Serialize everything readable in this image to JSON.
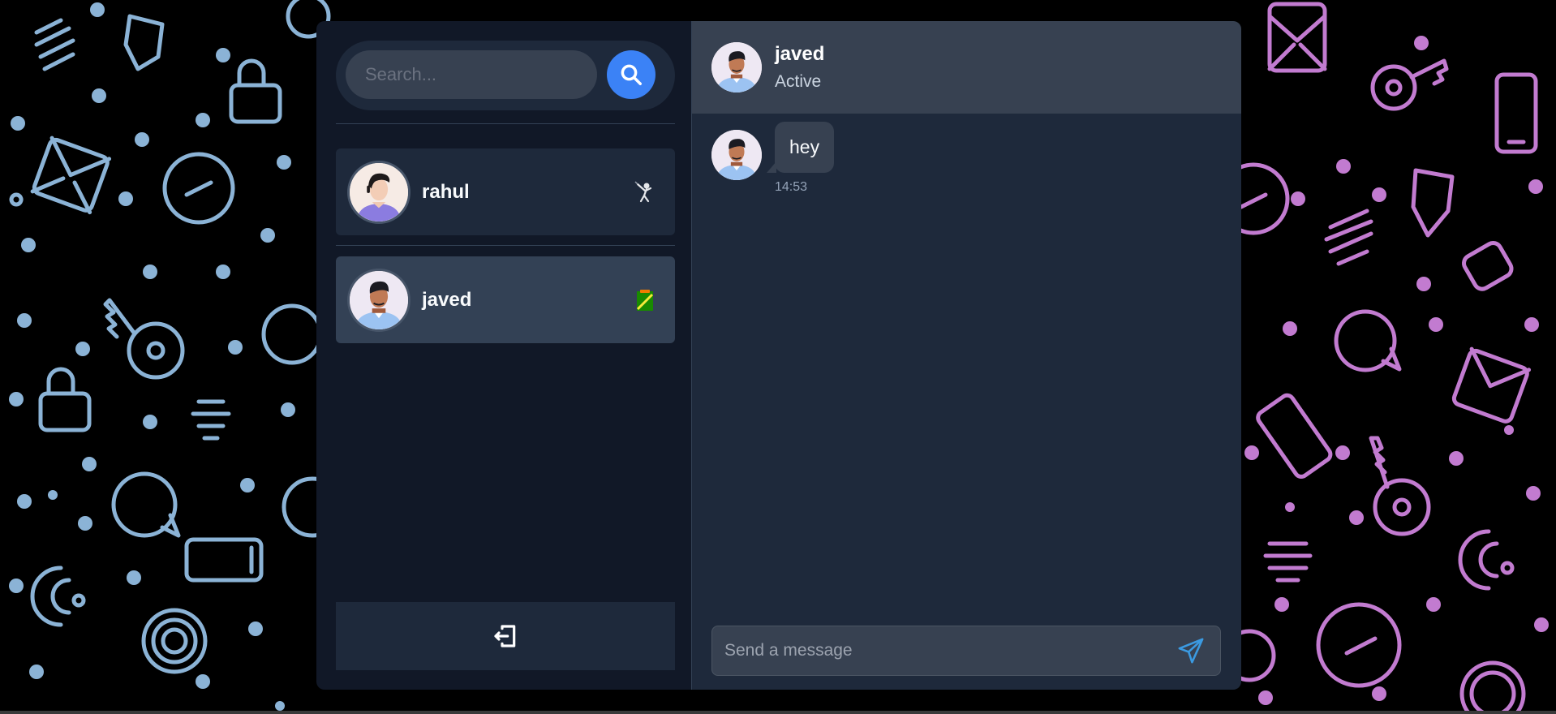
{
  "colors": {
    "accent": "#3b82f6",
    "panel": "#111827",
    "chat_bg": "#1e293b",
    "header_bg": "#374151",
    "pattern_left": "#8bb3d6",
    "pattern_right": "#c27bd0"
  },
  "search": {
    "placeholder": "Search...",
    "button_icon": "search-icon"
  },
  "contacts": [
    {
      "name": "rahul",
      "status_icon": "fencing-icon",
      "active": false
    },
    {
      "name": "javed",
      "status_icon": "zambia-flag-icon",
      "active": true
    }
  ],
  "logout": {
    "icon": "logout-icon"
  },
  "chat": {
    "header": {
      "name": "javed",
      "status": "Active"
    },
    "messages": [
      {
        "text": "hey",
        "time": "14:53"
      }
    ],
    "composer": {
      "placeholder": "Send a message",
      "send_icon": "send-icon"
    }
  }
}
